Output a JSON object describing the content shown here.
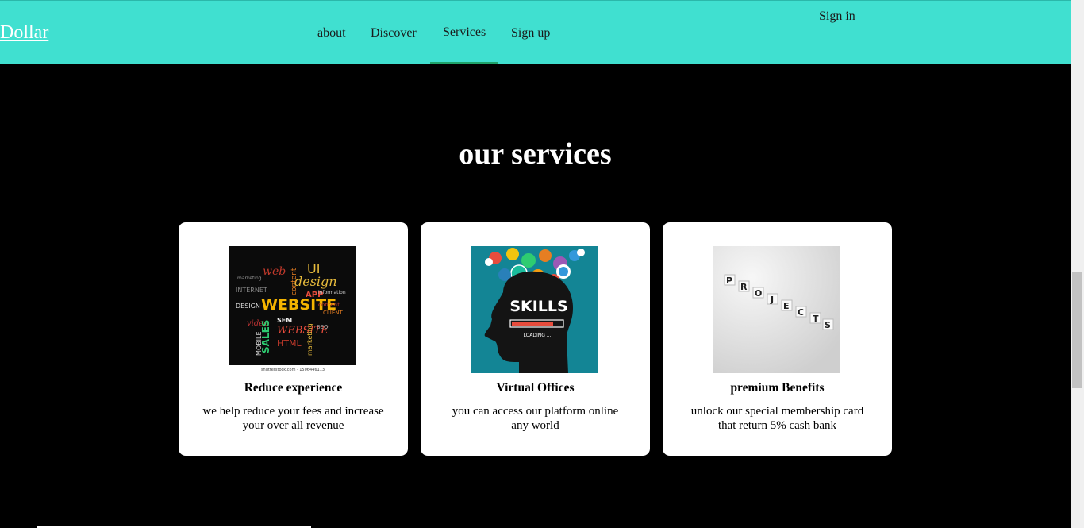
{
  "nav": {
    "logo": "Dollar",
    "links": [
      "about",
      "Discover",
      "Services",
      "Sign up"
    ],
    "signin": "Sign in",
    "active": "Services"
  },
  "section": {
    "title": "our services"
  },
  "cards": [
    {
      "title": "Reduce experience",
      "desc": "we help reduce your fees and increase your over all revenue",
      "image": "website word cloud"
    },
    {
      "title": "Virtual Offices",
      "desc": "you can access our platform online any world",
      "image": "skills head with gears"
    },
    {
      "title": "premium Benefits",
      "desc": "unlock our special membership card that return 5% cash bank",
      "image": "projects blocks"
    }
  ],
  "img_text": {
    "website": "WEBSITE",
    "design": "design",
    "web": "web",
    "sales": "SALES",
    "sem": "SEM",
    "content": "content",
    "internet": "INTERNET",
    "html": "HTML",
    "app": "APP",
    "ui": "UI",
    "video": "video",
    "mobile": "MOBILE",
    "marketing": "marketing",
    "client": "CLIENT",
    "info": "information",
    "seo": "SEO",
    "watermark": "shutterstock.com · 1506446113",
    "skills": "SKILLS",
    "loading": "LOADING ...",
    "projects": [
      "P",
      "R",
      "O",
      "J",
      "E",
      "C",
      "T",
      "S"
    ]
  },
  "colors": {
    "navbar": "#40e0d0",
    "active_underline": "#1fa36a",
    "background": "#000000",
    "card": "#ffffff"
  }
}
